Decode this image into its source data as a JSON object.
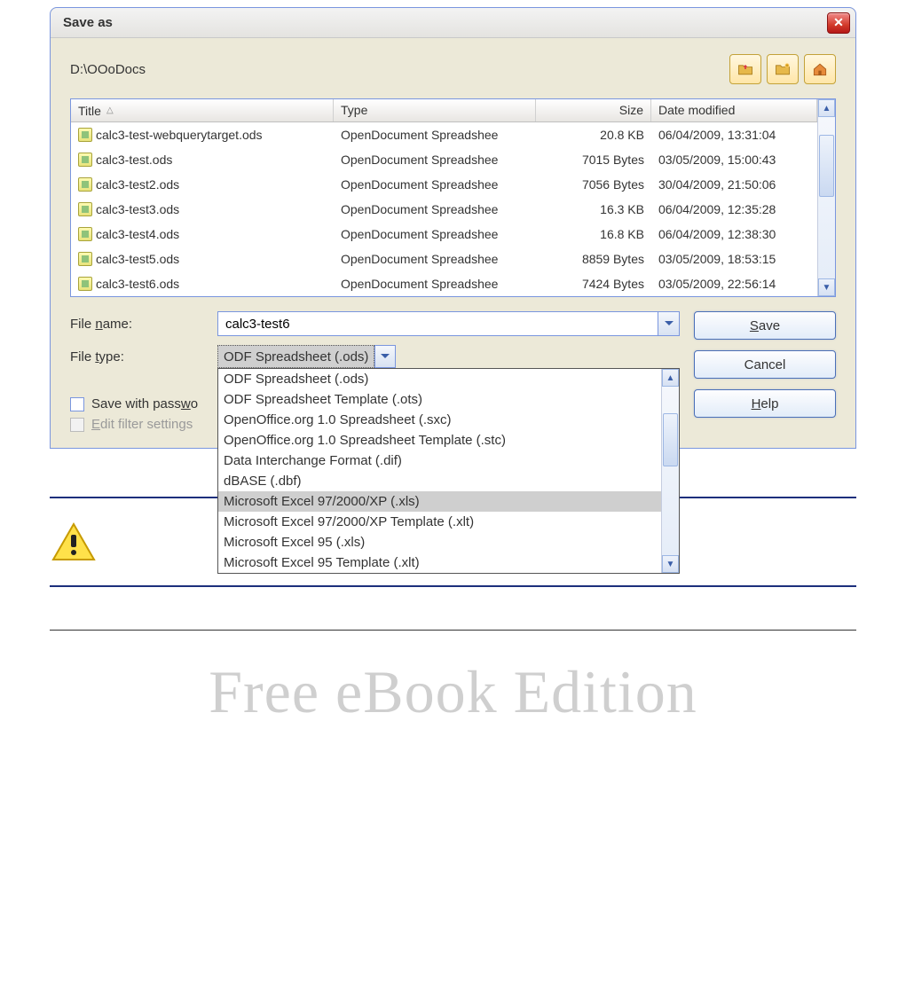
{
  "dialog": {
    "title": "Save as",
    "path": "D:\\OOoDocs",
    "columns": {
      "title": "Title",
      "type": "Type",
      "size": "Size",
      "date": "Date modified"
    },
    "files": [
      {
        "name": "calc3-test-webquerytarget.ods",
        "type": "OpenDocument Spreadshee",
        "size": "20.8 KB",
        "date": "06/04/2009, 13:31:04"
      },
      {
        "name": "calc3-test.ods",
        "type": "OpenDocument Spreadshee",
        "size": "7015 Bytes",
        "date": "03/05/2009, 15:00:43"
      },
      {
        "name": "calc3-test2.ods",
        "type": "OpenDocument Spreadshee",
        "size": "7056 Bytes",
        "date": "30/04/2009, 21:50:06"
      },
      {
        "name": "calc3-test3.ods",
        "type": "OpenDocument Spreadshee",
        "size": "16.3 KB",
        "date": "06/04/2009, 12:35:28"
      },
      {
        "name": "calc3-test4.ods",
        "type": "OpenDocument Spreadshee",
        "size": "16.8 KB",
        "date": "06/04/2009, 12:38:30"
      },
      {
        "name": "calc3-test5.ods",
        "type": "OpenDocument Spreadshee",
        "size": "8859 Bytes",
        "date": "03/05/2009, 18:53:15"
      },
      {
        "name": "calc3-test6.ods",
        "type": "OpenDocument Spreadshee",
        "size": "7424 Bytes",
        "date": "03/05/2009, 22:56:14"
      }
    ],
    "filename_label": "File name:",
    "filename_value": "calc3-test6",
    "filetype_label": "File type:",
    "filetype_selected": "ODF Spreadsheet (.ods)",
    "filetype_options": [
      "ODF Spreadsheet (.ods)",
      "ODF Spreadsheet Template (.ots)",
      "OpenOffice.org 1.0 Spreadsheet (.sxc)",
      "OpenOffice.org 1.0 Spreadsheet Template (.stc)",
      "Data Interchange Format (.dif)",
      "dBASE (.dbf)",
      "Microsoft Excel 97/2000/XP (.xls)",
      "Microsoft Excel 97/2000/XP Template (.xlt)",
      "Microsoft Excel 95 (.xls)",
      "Microsoft Excel 95 Template (.xlt)"
    ],
    "filetype_highlight": "Microsoft Excel 97/2000/XP (.xls)",
    "save_password_label": "Save with passwo",
    "edit_filter_label": "Edit filter settings",
    "buttons": {
      "save": "Save",
      "cancel": "Cancel",
      "help": "Help"
    }
  },
  "watermark": "Free eBook Edition"
}
